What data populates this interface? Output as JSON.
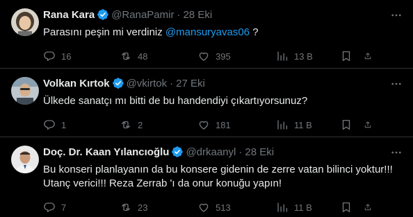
{
  "tweets": [
    {
      "name": "Rana Kara",
      "handle": "@RanaPamir",
      "separator": "·",
      "date": "28 Eki",
      "text_before": "Parasını peşin mi verdiniz ",
      "mention": "@mansuryavas06",
      "text_after": " ?",
      "replies": "16",
      "retweets": "48",
      "likes": "395",
      "views": "13 B"
    },
    {
      "name": "Volkan Kırtok",
      "handle": "@vkirtok",
      "separator": "·",
      "date": "27 Eki",
      "text": "Ülkede sanatçı mı bitti de bu handendiyi çıkartıyorsunuz?",
      "replies": "1",
      "retweets": "2",
      "likes": "181",
      "views": "11 B"
    },
    {
      "name": "Doç. Dr. Kaan Yılancıoğlu",
      "handle": "@drkaanyl",
      "separator": "·",
      "date": "28 Eki",
      "text_line1": "Bu konseri planlayanın da bu konsere gidenin de zerre vatan bilinci yoktur!!!",
      "text_line2": "Utanç verici!!! Reza Zerrab 'ı da onur konuğu yapın!",
      "replies": "7",
      "retweets": "23",
      "likes": "513",
      "views": "11 B"
    }
  ],
  "colors": {
    "background": "#000000",
    "text": "#e7e9ea",
    "secondary": "#71767b",
    "accent": "#1d9bf0",
    "divider": "#2f3336"
  },
  "icons": [
    "verified-badge-icon",
    "more-icon",
    "reply-icon",
    "retweet-icon",
    "like-icon",
    "views-icon",
    "bookmark-icon",
    "share-icon"
  ]
}
